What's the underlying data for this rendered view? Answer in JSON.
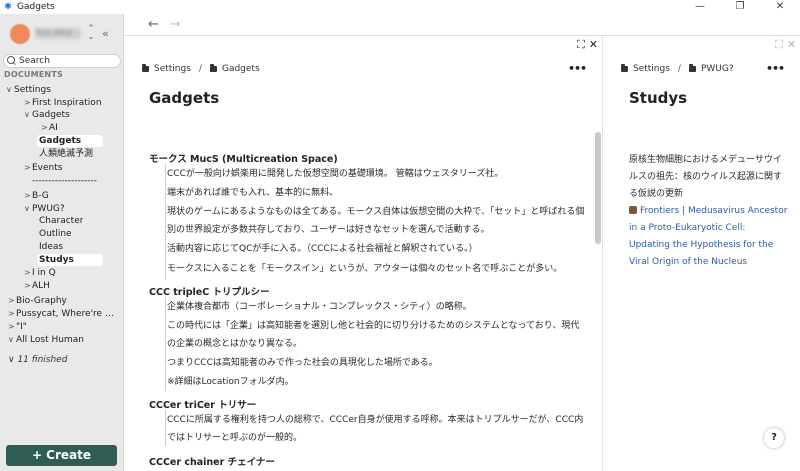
{
  "window": {
    "title": "Gadgets",
    "controls": {
      "minimize": "—",
      "restore": "❐",
      "close": "✕"
    }
  },
  "sidebar": {
    "profile_name": "Yuu Akiz",
    "search_label": "Search",
    "section_label": "DOCUMENTS",
    "tree": [
      {
        "label": "Settings",
        "chevron": "∨"
      },
      {
        "label": "First Inspiration",
        "chevron": ">"
      },
      {
        "label": "Gadgets",
        "chevron": "∨"
      },
      {
        "label": "AI",
        "chevron": ">"
      },
      {
        "label": "Gadgets",
        "chevron": ""
      },
      {
        "label": "人類絶滅予測",
        "chevron": ""
      },
      {
        "label": "Events",
        "chevron": ">"
      },
      {
        "label": "--------------------",
        "chevron": ""
      },
      {
        "label": "B-G",
        "chevron": ">"
      },
      {
        "label": "PWUG?",
        "chevron": "∨"
      },
      {
        "label": "Character",
        "chevron": ""
      },
      {
        "label": "Outline",
        "chevron": ""
      },
      {
        "label": "Ideas",
        "chevron": ""
      },
      {
        "label": "Studys",
        "chevron": ""
      },
      {
        "label": "I in Q",
        "chevron": ">"
      },
      {
        "label": "ALH",
        "chevron": ">"
      },
      {
        "label": "Bio-Graphy",
        "chevron": ">"
      },
      {
        "label": "Pussycat, Where're …",
        "chevron": ">"
      },
      {
        "label": "\"I\"",
        "chevron": ">"
      },
      {
        "label": "All Lost Human",
        "chevron": "∨"
      }
    ],
    "finished": "11 finished",
    "create_label": "+ Create"
  },
  "nav": {
    "back": "←",
    "forward": "→"
  },
  "left_pane": {
    "breadcrumb": [
      "Settings",
      "Gadgets"
    ],
    "title": "Gadgets",
    "sections": [
      {
        "heading": "モークス MucS (Multicreation Space)",
        "paras": [
          "CCCが一般向け娯楽用に開発した仮想空間の基礎環境。 管轄はウェスタリーズ社。",
          "端末があれば誰でも入れ、基本的に無料。",
          "現状のゲームにあるようなものは全てある。モークス自体は仮想空間の大枠で、「セット」と呼ばれる個別の世界設定が多数共存しており、ユーザーは好きなセットを選んで活動する。",
          "活動内容に応じてQCが手に入る。（CCCによる社会福祉と解釈されている。）",
          "モークスに入ることを「モークスイン」というが、アウターは個々のセット名で呼ぶことが多い。"
        ]
      },
      {
        "heading": "CCC tripleC トリプルシー",
        "paras": [
          "企業体複合都市（コーポレーショナル・コンプレックス・シティ）の略称。",
          "この時代には「企業」は高知能者を選別し他と社会的に切り分けるためのシステムとなっており、現代の企業の概念とはかなり異なる。",
          "つまりCCCは高知能者のみで作った社会の具現化した場所である。",
          "※詳細はLocationフォルダ内。"
        ]
      },
      {
        "heading": "CCCer triCer トリサー",
        "paras": [
          "CCCに所属する権利を持つ人の総称で、CCCer自身が使用する呼称。本来はトリプルサーだが、CCC内ではトリサーと呼ぶのが一般的。"
        ]
      },
      {
        "heading": "CCCer chainer チェイナー",
        "paras": []
      }
    ]
  },
  "right_pane": {
    "breadcrumb": [
      "Settings",
      "PWUG?"
    ],
    "title": "Studys",
    "text": "原核生物細胞におけるメデューサウイルスの祖先：核のウイルス起源に関する仮説の更新",
    "link": "Frontiers | Medusavirus Ancestor in a Proto-Eukaryotic Cell: Updating the Hypothesis for the Viral Origin of the Nucleus",
    "help": "?"
  },
  "pane_tools": {
    "expand": "⛶",
    "close": "✕",
    "more": "•••"
  },
  "colors": {
    "create_button": "#2f5d53",
    "link": "#2f5aa8",
    "sidebar_bg": "#e9e9e9"
  }
}
